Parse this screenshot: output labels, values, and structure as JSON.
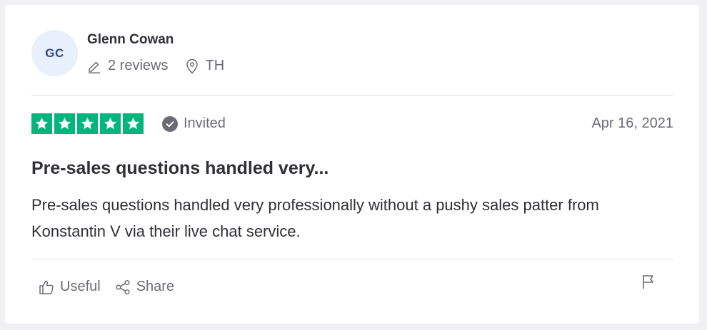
{
  "reviewer": {
    "initials": "GC",
    "name": "Glenn Cowan",
    "reviews_count": "2 reviews",
    "country": "TH",
    "avatar_bg": "#e8f0fb",
    "avatar_fg": "#2c4a86"
  },
  "review": {
    "rating": 5,
    "star_color": "#00b67a",
    "status": "Invited",
    "date": "Apr 16, 2021",
    "title": "Pre-sales questions handled very...",
    "body": "Pre-sales questions handled very professionally without a pushy sales patter from Konstantin V via their live chat service."
  },
  "actions": {
    "useful_label": "Useful",
    "share_label": "Share",
    "icons": [
      "thumbs-up-icon",
      "share-icon",
      "flag-icon"
    ]
  }
}
